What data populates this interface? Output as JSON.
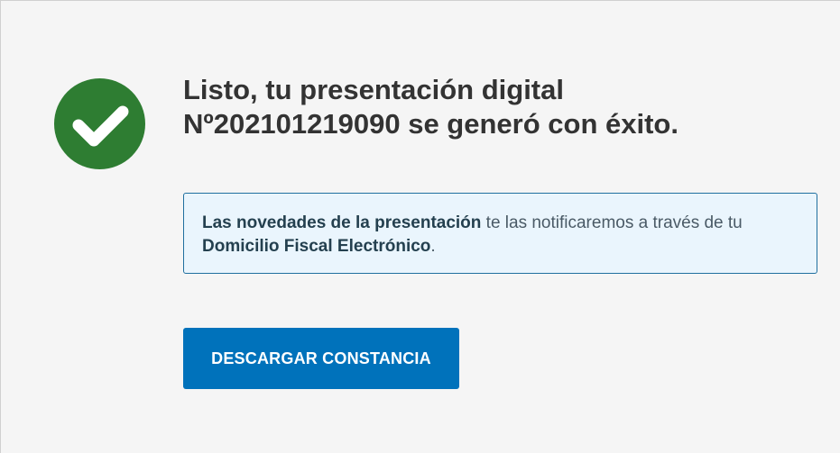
{
  "status": {
    "icon": "check-circle-icon",
    "color": "#2e7d32"
  },
  "title": {
    "line1": "Listo, tu presentación digital",
    "line2": "Nº202101219090 se generó con éxito."
  },
  "notice": {
    "bold_1": "Las novedades de la presentación",
    "text_1": " te las notificaremos a través de tu ",
    "bold_2": "Domicilio Fiscal Electrónico",
    "text_2": "."
  },
  "actions": {
    "download_label": "DESCARGAR CONSTANCIA",
    "download_color": "#0072bb"
  }
}
